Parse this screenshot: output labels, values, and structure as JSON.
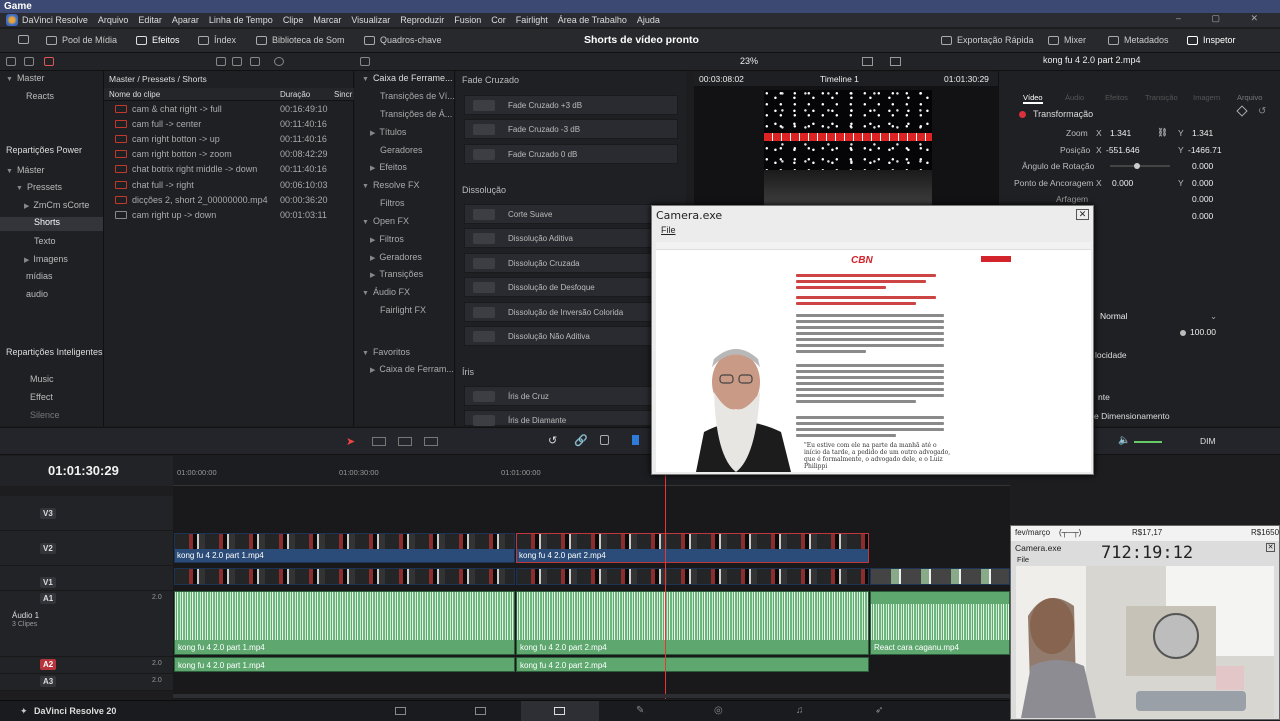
{
  "titlebar": {
    "title": "Game"
  },
  "menu": [
    "DaVinci Resolve",
    "Arquivo",
    "Editar",
    "Aparar",
    "Linha de Tempo",
    "Clipe",
    "Marcar",
    "Visualizar",
    "Reproduzir",
    "Fusion",
    "Cor",
    "Fairlight",
    "Área de Trabalho",
    "Ajuda"
  ],
  "toolbar": {
    "media_pool": "Pool de Mídia",
    "effects": "Efeitos",
    "index": "Índex",
    "sound_lib": "Biblioteca de Som",
    "keyframes": "Quadros-chave",
    "project_title": "Shorts de vídeo pronto",
    "quick_export": "Exportação Rápida",
    "mixer": "Mixer",
    "metadata": "Metadados",
    "inspector": "Inspetor"
  },
  "subbar": {
    "zoom": "23%",
    "timecode_left": "00:03:08:02",
    "timeline_name": "Timeline 1",
    "timecode_right": "01:01:30:29",
    "clip_name": "kong fu 4 2.0 part 2.mp4"
  },
  "bins": {
    "top_items": [
      "Master",
      "Reacts"
    ],
    "power_bins_label": "Repartições Power",
    "power_tree": [
      "Máster",
      "Pressets",
      "ZmCm sCorte",
      "Shorts",
      "Texto",
      "Imagens",
      "mídias",
      "audio"
    ],
    "smart_bins_label": "Repartições Inteligentes",
    "smart_items": [
      "Music",
      "Effect",
      "Silence"
    ]
  },
  "clips": {
    "breadcrumb": "Master / Pressets / Shorts",
    "col_name": "Nome do clipe",
    "col_duration": "Duração",
    "col_sync": "Sincr",
    "rows": [
      {
        "name": "cam & chat right -> full",
        "dur": "00:16:49:10"
      },
      {
        "name": "cam full -> center",
        "dur": "00:11:40:16"
      },
      {
        "name": "cam right botton -> up",
        "dur": "00:11:40:16"
      },
      {
        "name": "cam right botton -> zoom",
        "dur": "00:08:42:29"
      },
      {
        "name": "chat botrix right middle -> down",
        "dur": "00:11:40:16"
      },
      {
        "name": "chat full -> right",
        "dur": "00:06:10:03"
      },
      {
        "name": "dicções 2, short 2_00000000.mp4",
        "dur": "00:00:36:20"
      },
      {
        "name": "cam right up -> down",
        "dur": "00:01:03:11"
      }
    ]
  },
  "toolbox": {
    "header": "Caixa de Ferrame...",
    "items": [
      "Transições de Ví...",
      "Transições de Á...",
      "Títulos",
      "Geradores",
      "Efeitos",
      "Resolve FX",
      "Filtros",
      "Open FX",
      "Filtros",
      "Geradores",
      "Transições",
      "Áudio FX",
      "Fairlight FX",
      "Favoritos",
      "Caixa de Ferram..."
    ]
  },
  "effects": {
    "sec1": "Fade Cruzado",
    "sec1_items": [
      "Fade Cruzado +3 dB",
      "Fade Cruzado -3 dB",
      "Fade Cruzado 0 dB"
    ],
    "sec2": "Dissolução",
    "sec2_items": [
      "Corte Suave",
      "Dissolução Aditiva",
      "Dissolução Cruzada",
      "Dissolução de Desfoque",
      "Dissolução de Inversão Colorida",
      "Dissolução Não Aditiva"
    ],
    "sec3": "Íris",
    "sec3_items": [
      "Íris de Cruz",
      "Íris de Diamante"
    ]
  },
  "inspector": {
    "tabs": [
      "Vídeo",
      "Áudio",
      "Efeitos",
      "Transição",
      "Imagem",
      "Arquivo"
    ],
    "section": "Transformação",
    "zoom_label": "Zoom",
    "zoom_x": "1.341",
    "zoom_y": "1.341",
    "pos_label": "Posição",
    "pos_x": "-551.646",
    "pos_y": "-1466.71",
    "rot_label": "Ângulo de Rotação",
    "rot": "0.000",
    "anchor_label": "Ponto de Ancoragem",
    "anchor_x": "0.000",
    "anchor_y": "0.000",
    "pitch_label": "Arfagem",
    "pitch": "0.000",
    "blend": "Normal",
    "opacity": "100.00",
    "speed": "locidade",
    "scaling": "e Dimensionamento",
    "dim": "DIM",
    "x_letter": "X",
    "y_letter": "Y"
  },
  "timeline": {
    "timecode": "01:01:30:29",
    "ruler": [
      "01:00:00:00",
      "01:00:30:00",
      "01:01:00:00"
    ],
    "tracks": [
      "V3",
      "V2",
      "V1",
      "A1",
      "A2",
      "A3"
    ],
    "audio_label": "Áudio 1",
    "audio_clips": "3 Clipes",
    "level": "2.0",
    "clips": {
      "v2a": "kong fu 4 2.0 part 1.mp4",
      "v2b": "kong fu 4 2.0 part 2.mp4",
      "a1a": "kong fu 4 2.0 part 1.mp4",
      "a1b": "kong fu 4 2.0 part 2.mp4",
      "a1c": "React cara caganu.mp4",
      "a2a": "kong fu 4 2.0 part 1.mp4",
      "a2b": "kong fu 4 2.0 part 2.mp4"
    }
  },
  "bottom": {
    "app": "DaVinci Resolve 20"
  },
  "camera_window": {
    "title": "Camera.exe",
    "menu": "File",
    "site": "CBN",
    "quote": "\"Eu estive com ele na parte da manhã até o início da tarde, a pedido de um outro advogado, que é formalmente, o advogado dele, e o Luiz Philippi"
  },
  "facecam": {
    "header_left": "fev/março",
    "header_mid": "R$17,17",
    "header_right": "R$1650",
    "title": "Camera.exe",
    "menu": "File",
    "clock": "712:19:12"
  }
}
